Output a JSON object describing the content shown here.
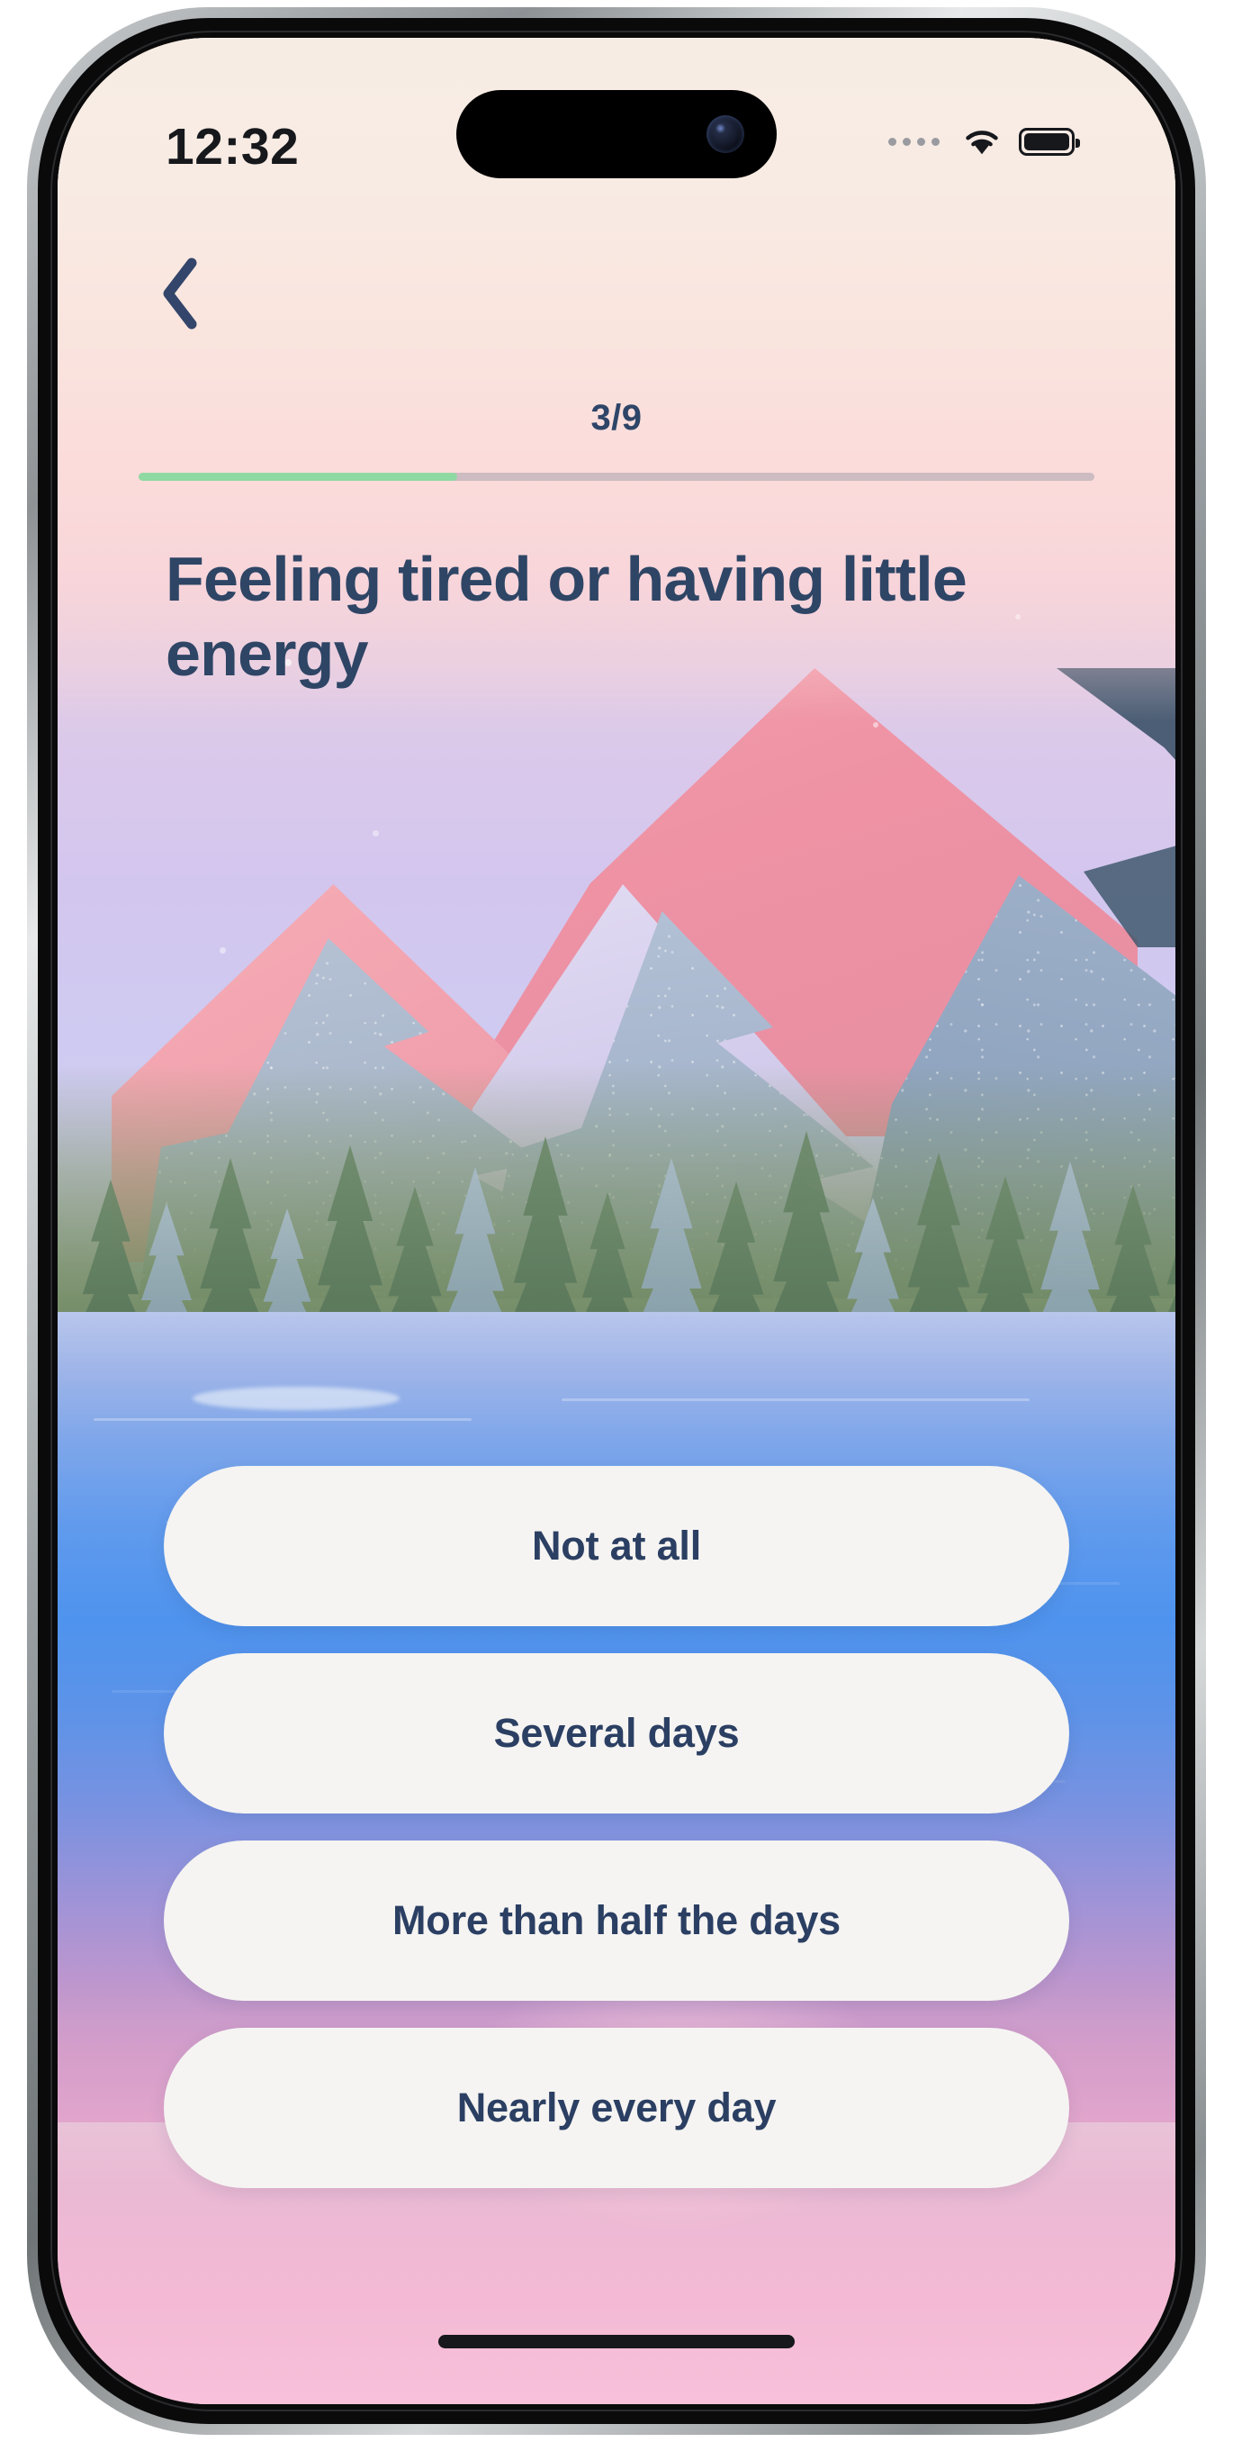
{
  "status_bar": {
    "time": "12:32",
    "signal_dots_icon": "signal-dots-icon",
    "wifi_icon": "wifi-icon",
    "battery_icon": "battery-full-icon"
  },
  "header": {
    "back_icon": "chevron-left-icon",
    "progress_label": "3/9",
    "progress_current": 3,
    "progress_total": 9,
    "progress_percent": 33.3,
    "progress_fill_color": "#8fd9a3",
    "progress_track_color": "#cdbcc1"
  },
  "main": {
    "question": "Feeling tired or having little energy",
    "text_color": "#2e4565"
  },
  "answers": [
    {
      "label": "Not at all"
    },
    {
      "label": "Several days"
    },
    {
      "label": "More than half the days"
    },
    {
      "label": "Nearly every day"
    }
  ],
  "theme": {
    "sky_top": "#f7ece4",
    "sky_bottom": "#cfd2f3",
    "water_blue": "#4e93ee",
    "button_bg": "#f5f4f2",
    "accent_navy": "#2b3f63"
  }
}
